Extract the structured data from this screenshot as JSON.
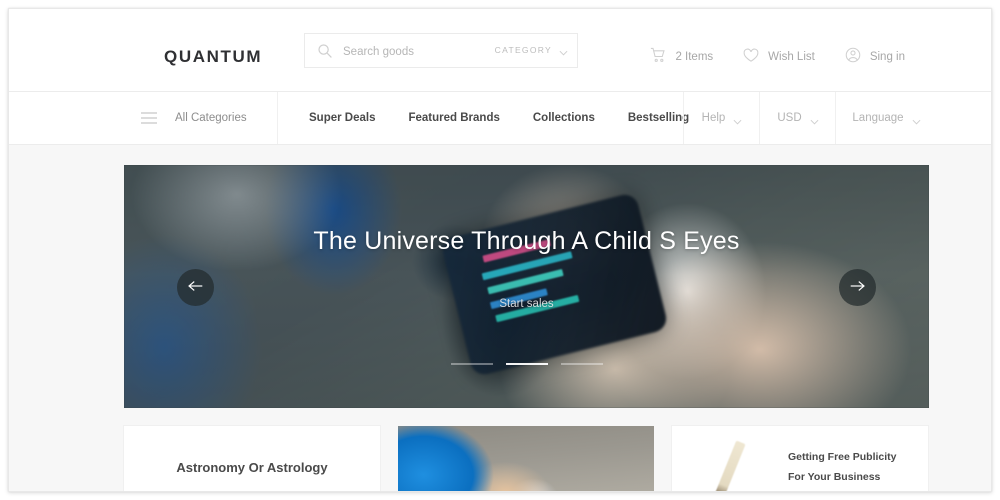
{
  "header": {
    "logo": "QUANTUM",
    "search": {
      "placeholder": "Search goods",
      "value": "",
      "icon": "search-icon",
      "category_label": "CATEGORY",
      "category_caret": "chevron-down-icon"
    },
    "actions": [
      {
        "icon": "cart-icon",
        "label": "2 Items"
      },
      {
        "icon": "heart-icon",
        "label": "Wish List"
      },
      {
        "icon": "user-icon",
        "label": "Sing in"
      }
    ]
  },
  "nav": {
    "menu_icon": "hamburger-icon",
    "all_categories": "All Categories",
    "items": [
      {
        "label": "Super Deals"
      },
      {
        "label": "Featured Brands"
      },
      {
        "label": "Collections"
      },
      {
        "label": "Bestselling"
      }
    ],
    "right": [
      {
        "label": "Help",
        "caret": "chevron-down-icon"
      },
      {
        "label": "USD",
        "caret": "chevron-down-icon"
      },
      {
        "label": "Language",
        "caret": "chevron-down-icon"
      }
    ]
  },
  "hero": {
    "title": "The Universe Through A Child S Eyes",
    "cta": "Start sales",
    "prev_icon": "arrow-left-icon",
    "next_icon": "arrow-right-icon",
    "slides": 3,
    "active_slide": 2
  },
  "cards": [
    {
      "type": "text",
      "title": "Astronomy Or Astrology"
    },
    {
      "type": "photo",
      "title": ""
    },
    {
      "type": "pencil",
      "line1": "Getting Free Publicity",
      "line2": "For Your Business"
    }
  ],
  "colors": {
    "page_bg": "#f7f7f7",
    "surface": "#ffffff",
    "text_dark": "#4a4a4a",
    "text_muted": "#a7a7a7",
    "hero_overlay": "#3c4649"
  }
}
